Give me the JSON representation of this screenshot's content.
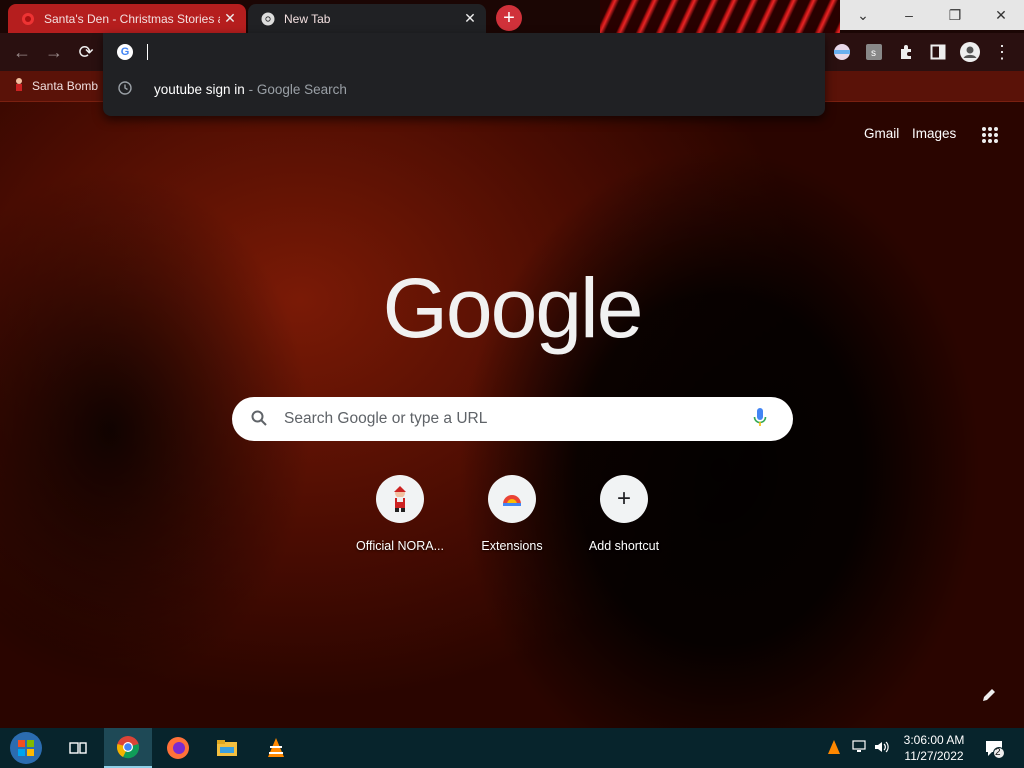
{
  "tabs": [
    {
      "title": "Santa's Den - Christmas Stories a",
      "close": "✕"
    },
    {
      "title": "New Tab",
      "close": "✕"
    }
  ],
  "new_tab_button": "+",
  "window_controls": {
    "dropdown": "⌄",
    "minimize": "–",
    "restore": "❐",
    "close": "✕"
  },
  "toolbar": {
    "back": "←",
    "forward": "→",
    "reload": "⟳",
    "menu": "⋮"
  },
  "bookmarks": [
    {
      "label": "Santa Bomb"
    }
  ],
  "omnibox": {
    "value": "",
    "suggestion": {
      "query": "youtube sign in",
      "suffix": " - Google Search"
    }
  },
  "ntp": {
    "gmail": "Gmail",
    "images": "Images",
    "logo_text": "Google",
    "search_placeholder": "Search Google or type a URL",
    "shortcuts": [
      {
        "label": "Official NORA...",
        "icon": "santa-icon"
      },
      {
        "label": "Extensions",
        "icon": "chrome-web-store-icon"
      },
      {
        "label": "Add shortcut",
        "icon": "plus-icon",
        "symbol": "+"
      }
    ]
  },
  "taskbar": {
    "time": "3:06:00 AM",
    "date": "11/27/2022",
    "notifications": "2"
  },
  "colors": {
    "active_tab": "#b51e1e",
    "new_tab_button": "#d0313a",
    "taskbar": "#07242c"
  }
}
